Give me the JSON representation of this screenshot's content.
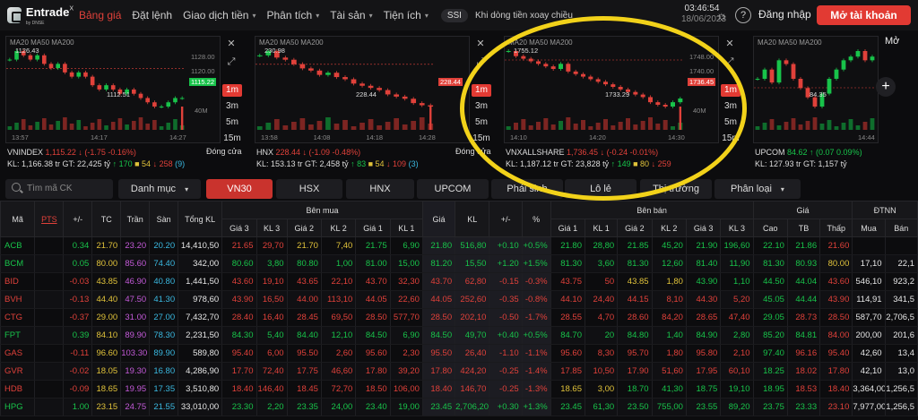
{
  "brand": {
    "name": "Entrade",
    "sup": "X",
    "sub": "by DNSE"
  },
  "nav": [
    {
      "label": "Bảng giá",
      "active": true
    },
    {
      "label": "Đặt lệnh"
    },
    {
      "label": "Giao dịch tiền",
      "caret": true
    },
    {
      "label": "Phân tích",
      "caret": true
    },
    {
      "label": "Tài sản",
      "caret": true
    },
    {
      "label": "Tiện ích",
      "caret": true
    }
  ],
  "ssi": "SSI",
  "notice": "Khi dòng tiền xoay chiều",
  "clock": {
    "time": "03:46:54",
    "date": "18/06/2023"
  },
  "header_actions": {
    "login": "Đăng nhập",
    "signup": "Mở tài khoản"
  },
  "colors": {
    "accent": "#e23a33",
    "up": "#18c34a",
    "down": "#e0413a",
    "ref": "#e0c23a",
    "ceil": "#c35ad8",
    "floor": "#3ab8e0",
    "annotation": "#f2d21a"
  },
  "icons": {
    "theme": "sun-icon",
    "help": "help-icon",
    "close": "close-icon",
    "expand": "expand-icon",
    "search": "search-icon",
    "add": "plus-icon"
  },
  "charts": [
    {
      "ma": "MA20 MA50 MA200",
      "high": "1126.43",
      "low": "1112.51",
      "yt": [
        "1128.00",
        "1120.00"
      ],
      "last": "1115.22",
      "vol": "40M",
      "xt": [
        "13:57",
        "14:17",
        "14:27"
      ],
      "name": "VNINDEX",
      "price": "1,115.22",
      "chg": "(-1.75 -0.16%)",
      "kl": "KL: 1,166.38 tr",
      "gt": "GT: 22,425 tỷ",
      "status": "Đóng cửa",
      "adv": "170",
      "ref": "54",
      "dec": "258",
      "flr": "(9)",
      "tfs": [
        "1m",
        "3m",
        "5m",
        "15m"
      ],
      "tf_on": 0,
      "close_values": [
        1124,
        1126,
        1125,
        1124,
        1125,
        1123,
        1122,
        1123,
        1121,
        1120,
        1121,
        1120,
        1118,
        1117,
        1118,
        1117,
        1116,
        1117,
        1116,
        1115,
        1114,
        1113,
        1113,
        1114,
        1115,
        1115
      ]
    },
    {
      "ma": "MA20 MA50 MA200",
      "high": "230.98",
      "low": "228.44",
      "yt": [],
      "last": "228.44",
      "vol": "",
      "xt": [
        "13:58",
        "14:08",
        "14:18",
        "14:28"
      ],
      "name": "HNX",
      "price": "228.44",
      "chg": "(-1.09 -0.48%)",
      "kl": "KL: 153.13 tr",
      "gt": "GT: 2,458 tỷ",
      "status": "Đóng cửa",
      "adv": "83",
      "ref": "54",
      "dec": "109",
      "flr": "(3)",
      "tfs": [
        "1m",
        "3m",
        "5m",
        "15m"
      ],
      "tf_on": 0,
      "close_values": [
        230.8,
        231,
        230.7,
        230.6,
        230.4,
        230.2,
        230.1,
        229.9,
        230,
        229.8,
        229.7,
        229.5,
        229.4,
        229.3,
        229.2,
        229,
        228.9,
        228.8,
        228.6,
        228.5,
        228.44
      ]
    },
    {
      "ma": "MA20 MA50 MA200",
      "high": "1755.12",
      "low": "1733.29",
      "yt": [
        "1748.00",
        "1740.00"
      ],
      "last": "1736.45",
      "vol": "40M",
      "xt": [
        "14:10",
        "14:20",
        "14:30"
      ],
      "name": "VNXALLSHARE",
      "price": "1,736.45",
      "chg": "(-0.24 -0.01%)",
      "kl": "KL: 1,187.12 tr",
      "gt": "GT: 23,828 tỷ",
      "status": "",
      "adv": "149",
      "ref": "80",
      "dec": "259",
      "flr": "",
      "tfs": [
        "1m",
        "3m",
        "5m",
        "15m"
      ],
      "tf_on": 0,
      "close_values": [
        1755,
        1753,
        1752,
        1751,
        1750,
        1749,
        1748,
        1750,
        1747,
        1746,
        1745,
        1744,
        1743,
        1742,
        1741,
        1740,
        1739,
        1738,
        1737,
        1735,
        1734,
        1733.3,
        1735,
        1736.45
      ]
    },
    {
      "ma": "MA20 MA50 MA200",
      "high": "",
      "low": "84.35",
      "yt": [],
      "last": "",
      "vol": "",
      "xt": [
        "14:44"
      ],
      "name": "UPCOM",
      "price": "84.62",
      "chg": "(0.07 0.09%)",
      "kl": "KL: 127.93 tr",
      "gt": "GT: 1,157 tỷ",
      "status": "",
      "adv": "",
      "ref": "",
      "dec": "",
      "flr": "",
      "tfs": [],
      "tf_on": -1,
      "close_values": [
        84.5,
        84.55,
        84.48,
        84.6,
        84.58,
        84.5,
        84.45,
        84.4,
        84.35,
        84.42,
        84.5,
        84.55,
        84.6,
        84.62,
        84.65,
        84.6,
        84.62
      ]
    }
  ],
  "more_label": "Mở",
  "tabs": {
    "search_placeholder": "Tìm mã CK",
    "items": [
      "Danh mục",
      "VN30",
      "HSX",
      "HNX",
      "UPCOM",
      "Phái sinh",
      "Lô lẻ",
      "Thị trường",
      "Phân loại"
    ],
    "active": 1
  },
  "table": {
    "group_headers": {
      "buy": "Bên mua",
      "match": "",
      "sell": "Bên bán",
      "price": "Giá",
      "foreign": "ĐTNN"
    },
    "columns": [
      "Mã",
      "PTS",
      "+/-",
      "TC",
      "Trần",
      "Sàn",
      "Tổng KL",
      "Giá 3",
      "KL 3",
      "Giá 2",
      "KL 2",
      "Giá 1",
      "KL 1",
      "Giá",
      "KL",
      "+/-",
      "%",
      "Giá 1",
      "KL 1",
      "Giá 2",
      "KL 2",
      "Giá 3",
      "KL 3",
      "Cao",
      "TB",
      "Thấp",
      "Mua",
      "Bán"
    ],
    "rows": [
      [
        "ACB",
        "0.34",
        "21.70",
        "23.20",
        "20.20",
        "14,410,50",
        "21.65",
        "29,70",
        "21.70",
        "7,40",
        "21.75",
        "6,90",
        "21.80",
        "516,80",
        "+0.10",
        "+0.5%",
        "21.80",
        "28,80",
        "21.85",
        "45,20",
        "21.90",
        "196,60",
        "22.10",
        "21.86",
        "21.60",
        "",
        ""
      ],
      [
        "BCM",
        "0.05",
        "80.00",
        "85.60",
        "74.40",
        "342,00",
        "80.60",
        "3,80",
        "80.80",
        "1,00",
        "81.00",
        "15,00",
        "81.20",
        "15,50",
        "+1.20",
        "+1.5%",
        "81.30",
        "3,60",
        "81.30",
        "12,60",
        "81.40",
        "11,90",
        "81.30",
        "80.93",
        "80.00",
        "17,10",
        "22,1"
      ],
      [
        "BID",
        "-0.03",
        "43.85",
        "46.90",
        "40.80",
        "1,441,50",
        "43.60",
        "19,10",
        "43.65",
        "22,10",
        "43.70",
        "32,30",
        "43.70",
        "62,80",
        "-0.15",
        "-0.3%",
        "43.75",
        "50",
        "43.85",
        "1,80",
        "43.90",
        "1,10",
        "44.50",
        "44.04",
        "43.60",
        "546,10",
        "923,2"
      ],
      [
        "BVH",
        "-0.13",
        "44.40",
        "47.50",
        "41.30",
        "978,60",
        "43.90",
        "16,50",
        "44.00",
        "113,10",
        "44.05",
        "22,60",
        "44.05",
        "252,60",
        "-0.35",
        "-0.8%",
        "44.10",
        "24,40",
        "44.15",
        "8,10",
        "44.30",
        "5,20",
        "45.05",
        "44.44",
        "43.90",
        "114,91",
        "341,5"
      ],
      [
        "CTG",
        "-0.37",
        "29.00",
        "31.00",
        "27.00",
        "7,432,70",
        "28.40",
        "16,40",
        "28.45",
        "69,50",
        "28.50",
        "577,70",
        "28.50",
        "202,10",
        "-0.50",
        "-1.7%",
        "28.55",
        "4,70",
        "28.60",
        "84,20",
        "28.65",
        "47,40",
        "29.05",
        "28.73",
        "28.50",
        "587,70",
        "2,706,5"
      ],
      [
        "FPT",
        "0.39",
        "84.10",
        "89.90",
        "78.30",
        "2,231,50",
        "84.30",
        "5,40",
        "84.40",
        "12,10",
        "84.50",
        "6,90",
        "84.50",
        "49,70",
        "+0.40",
        "+0.5%",
        "84.70",
        "20",
        "84.80",
        "1,40",
        "84.90",
        "2,80",
        "85.20",
        "84.81",
        "84.00",
        "200,00",
        "201,6"
      ],
      [
        "GAS",
        "-0.11",
        "96.60",
        "103.30",
        "89.90",
        "589,80",
        "95.40",
        "6,00",
        "95.50",
        "2,60",
        "95.60",
        "2,30",
        "95.50",
        "26,40",
        "-1.10",
        "-1.1%",
        "95.60",
        "8,30",
        "95.70",
        "1,80",
        "95.80",
        "2,10",
        "97.40",
        "96.16",
        "95.40",
        "42,60",
        "13,4"
      ],
      [
        "GVR",
        "-0.02",
        "18.05",
        "19.30",
        "16.80",
        "4,286,90",
        "17.70",
        "72,40",
        "17.75",
        "46,60",
        "17.80",
        "39,20",
        "17.80",
        "424,20",
        "-0.25",
        "-1.4%",
        "17.85",
        "10,50",
        "17.90",
        "51,60",
        "17.95",
        "60,10",
        "18.25",
        "18.02",
        "17.80",
        "42,10",
        "13,0"
      ],
      [
        "HDB",
        "-0.09",
        "18.65",
        "19.95",
        "17.35",
        "3,510,80",
        "18.40",
        "146,40",
        "18.45",
        "72,70",
        "18.50",
        "106,00",
        "18.40",
        "146,70",
        "-0.25",
        "-1.3%",
        "18.65",
        "3,00",
        "18.70",
        "41,30",
        "18.75",
        "19,10",
        "18.95",
        "18.53",
        "18.40",
        "3,364,00",
        "1,256,5"
      ],
      [
        "HPG",
        "1.00",
        "23.15",
        "24.75",
        "21.55",
        "33,010,00",
        "23.30",
        "2,20",
        "23.35",
        "24,00",
        "23.40",
        "19,00",
        "23.45",
        "2,706,20",
        "+0.30",
        "+1.3%",
        "23.45",
        "61,30",
        "23.50",
        "755,00",
        "23.55",
        "89,20",
        "23.75",
        "23.33",
        "23.10",
        "7,977,00",
        "1,256,5"
      ]
    ]
  }
}
